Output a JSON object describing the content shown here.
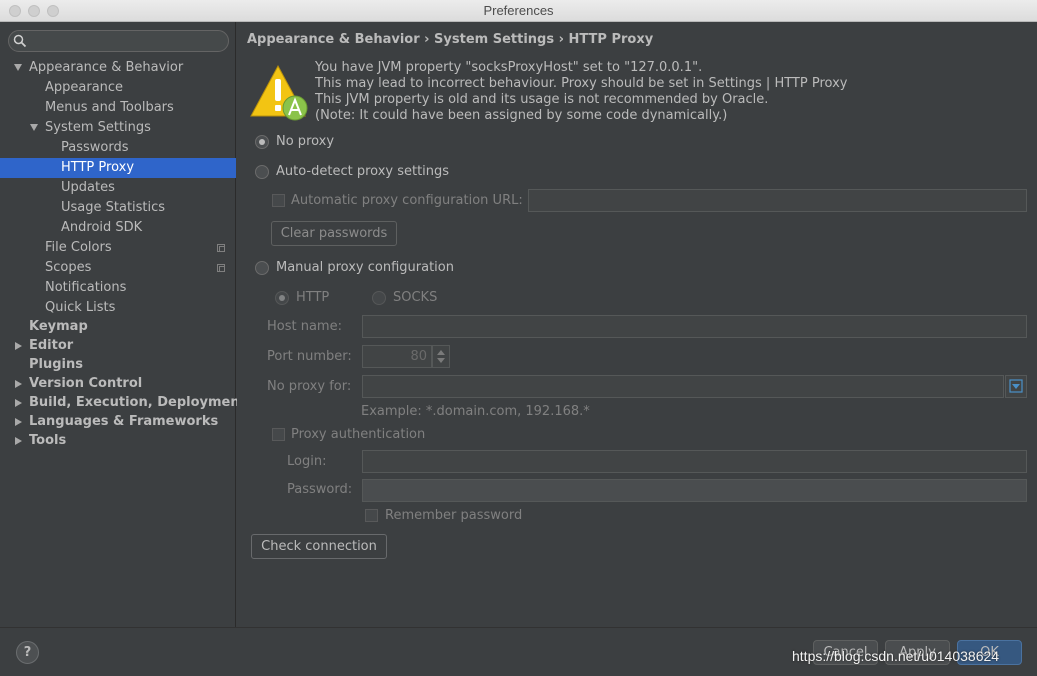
{
  "window": {
    "title": "Preferences"
  },
  "sidebar": {
    "search": {
      "value": "",
      "placeholder": ""
    },
    "items": [
      {
        "label": "Appearance & Behavior"
      },
      {
        "label": "Appearance"
      },
      {
        "label": "Menus and Toolbars"
      },
      {
        "label": "System Settings"
      },
      {
        "label": "Passwords"
      },
      {
        "label": "HTTP Proxy"
      },
      {
        "label": "Updates"
      },
      {
        "label": "Usage Statistics"
      },
      {
        "label": "Android SDK"
      },
      {
        "label": "File Colors"
      },
      {
        "label": "Scopes"
      },
      {
        "label": "Notifications"
      },
      {
        "label": "Quick Lists"
      },
      {
        "label": "Keymap"
      },
      {
        "label": "Editor"
      },
      {
        "label": "Plugins"
      },
      {
        "label": "Version Control"
      },
      {
        "label": "Build, Execution, Deployment"
      },
      {
        "label": "Languages & Frameworks"
      },
      {
        "label": "Tools"
      }
    ],
    "selected": "HTTP Proxy"
  },
  "breadcrumb": "Appearance & Behavior › System Settings › HTTP Proxy",
  "warning": {
    "icon": "warning-icon",
    "lines": [
      "You have JVM property \"socksProxyHost\" set to \"127.0.0.1\".",
      "This may lead to incorrect behaviour. Proxy should be set in Settings | HTTP Proxy",
      "This JVM property is old and its usage is not recommended by Oracle.",
      "(Note: It could have been assigned by some code dynamically.)"
    ]
  },
  "proxy": {
    "no_proxy_label": "No proxy",
    "auto_detect_label": "Auto-detect proxy settings",
    "auto_config_url_label": "Automatic proxy configuration URL:",
    "auto_config_url_value": "",
    "clear_passwords_label": "Clear passwords",
    "manual_label": "Manual proxy configuration",
    "selected_mode": "No proxy",
    "http_label": "HTTP",
    "socks_label": "SOCKS",
    "host_label": "Host name:",
    "host_value": "",
    "port_label": "Port number:",
    "port_value": "80",
    "no_proxy_for_label": "No proxy for:",
    "no_proxy_for_value": "",
    "example_text": "Example: *.domain.com, 192.168.*",
    "auth_label": "Proxy authentication",
    "login_label": "Login:",
    "login_value": "",
    "password_label": "Password:",
    "password_value": "",
    "remember_label": "Remember password",
    "check_connection_label": "Check connection"
  },
  "footer": {
    "help_label": "?",
    "cancel_label": "Cancel",
    "apply_label": "Apply",
    "ok_label": "OK",
    "watermark": "https://blog.csdn.net/u014038624"
  },
  "colors": {
    "background": "#3c3f41",
    "selection": "#2f65ca",
    "text": "#bbbbbb",
    "warning_yellow": "#f2c413",
    "android_green": "#8bc34a"
  }
}
